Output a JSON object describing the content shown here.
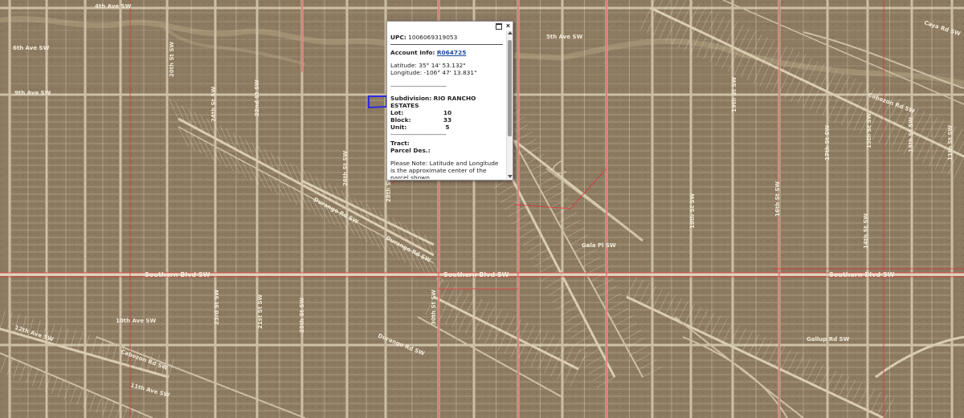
{
  "map": {
    "colors": {
      "terrain": "#8c7a61",
      "road": "#cdbfa6",
      "lot_line": "#eee4d0",
      "boundary": "#d83a3a",
      "selected_parcel": "#2a2ae0"
    },
    "road_labels": [
      "4th Ave SW",
      "5th Ave SW",
      "6th Ave SW",
      "Caya Rd SW",
      "Cabezon Rd SW",
      "Durango Rd SW",
      "Durango Rd SW",
      "Southern Blvd SW",
      "Southern Blvd SW",
      "Southern Blvd SW",
      "Gala Pl SW",
      "Gallup Rd SW",
      "Durango Rd SW",
      "Cabezon Rd SW",
      "11th Ave SW",
      "10th Ave SW",
      "12th Ave SW",
      "9th Ave SW",
      "20th St SW",
      "24th St SW",
      "22nd St SW",
      "26th St SW",
      "28th St SW",
      "30th St SW",
      "19th St SW",
      "17th St SW",
      "15th St SW",
      "13th St SW",
      "11th St SW",
      "18th St SW",
      "16th St SW",
      "14th St SW",
      "21st St SW",
      "23rd St SW",
      "25th St SW"
    ]
  },
  "popup": {
    "maximize_icon": "maximize-icon",
    "close_icon": "close-icon",
    "upc_label": "UPC:",
    "upc_value": "1006069319053",
    "account_label": "Account Info:",
    "account_value": "R064725",
    "latitude_label": "Latitude:",
    "latitude_value": "35° 14' 53.132\"",
    "longitude_label": "Longitude:",
    "longitude_value": "-106° 47' 13.831\"",
    "dash_line_1": "--------------------------------",
    "subdivision_label": "Subdivision:",
    "subdivision_value": "RIO RANCHO ESTATES",
    "lot_label": "Lot:",
    "lot_value": "10",
    "block_label": "Block:",
    "block_value": "33",
    "unit_label": "Unit:",
    "unit_value": "5",
    "dash_line_2": "--------------------------------",
    "tract_label": "Tract:",
    "parcel_des_label": "Parcel Des.:",
    "note": "Please Note: Latitude and Longitude is the approximate center of the parcel shown."
  }
}
